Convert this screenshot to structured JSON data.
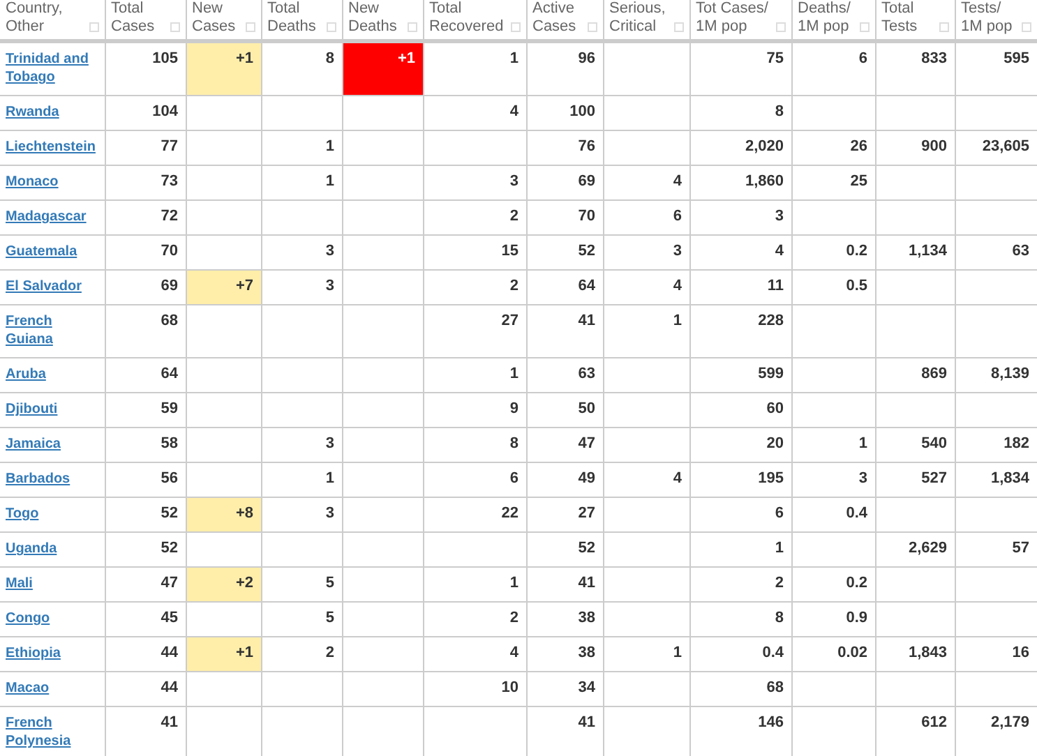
{
  "table": {
    "columns": [
      {
        "label": "Country, Other",
        "kind": "country"
      },
      {
        "label": "Total Cases",
        "kind": "total_cases"
      },
      {
        "label": "New Cases",
        "kind": "new_cases"
      },
      {
        "label": "Total Deaths",
        "kind": "number"
      },
      {
        "label": "New Deaths",
        "kind": "new_deaths"
      },
      {
        "label": "Total Recovered",
        "kind": "number"
      },
      {
        "label": "Active Cases",
        "kind": "number"
      },
      {
        "label": "Serious, Critical",
        "kind": "number"
      },
      {
        "label": "Tot Cases/ 1M pop",
        "kind": "number"
      },
      {
        "label": "Deaths/ 1M pop",
        "kind": "number"
      },
      {
        "label": "Total Tests",
        "kind": "number"
      },
      {
        "label": "Tests/ 1M pop",
        "kind": "number"
      }
    ],
    "rows": [
      {
        "cells": [
          "Trinidad and Tobago",
          "105",
          "+1",
          "8",
          "+1",
          "1",
          "96",
          null,
          "75",
          "6",
          "833",
          "595"
        ]
      },
      {
        "cells": [
          "Rwanda",
          "104",
          null,
          null,
          null,
          "4",
          "100",
          null,
          "8",
          null,
          null,
          null
        ]
      },
      {
        "cells": [
          "Liechtenstein",
          "77",
          null,
          "1",
          null,
          null,
          "76",
          null,
          "2,020",
          "26",
          "900",
          "23,605"
        ]
      },
      {
        "cells": [
          "Monaco",
          "73",
          null,
          "1",
          null,
          "3",
          "69",
          "4",
          "1,860",
          "25",
          null,
          null
        ]
      },
      {
        "cells": [
          "Madagascar",
          "72",
          null,
          null,
          null,
          "2",
          "70",
          "6",
          "3",
          null,
          null,
          null
        ]
      },
      {
        "cells": [
          "Guatemala",
          "70",
          null,
          "3",
          null,
          "15",
          "52",
          "3",
          "4",
          "0.2",
          "1,134",
          "63"
        ]
      },
      {
        "cells": [
          "El Salvador",
          "69",
          "+7",
          "3",
          null,
          "2",
          "64",
          "4",
          "11",
          "0.5",
          null,
          null
        ]
      },
      {
        "cells": [
          "French Guiana",
          "68",
          null,
          null,
          null,
          "27",
          "41",
          "1",
          "228",
          null,
          null,
          null
        ]
      },
      {
        "cells": [
          "Aruba",
          "64",
          null,
          null,
          null,
          "1",
          "63",
          null,
          "599",
          null,
          "869",
          "8,139"
        ]
      },
      {
        "cells": [
          "Djibouti",
          "59",
          null,
          null,
          null,
          "9",
          "50",
          null,
          "60",
          null,
          null,
          null
        ]
      },
      {
        "cells": [
          "Jamaica",
          "58",
          null,
          "3",
          null,
          "8",
          "47",
          null,
          "20",
          "1",
          "540",
          "182"
        ]
      },
      {
        "cells": [
          "Barbados",
          "56",
          null,
          "1",
          null,
          "6",
          "49",
          "4",
          "195",
          "3",
          "527",
          "1,834"
        ]
      },
      {
        "cells": [
          "Togo",
          "52",
          "+8",
          "3",
          null,
          "22",
          "27",
          null,
          "6",
          "0.4",
          null,
          null
        ]
      },
      {
        "cells": [
          "Uganda",
          "52",
          null,
          null,
          null,
          null,
          "52",
          null,
          "1",
          null,
          "2,629",
          "57"
        ]
      },
      {
        "cells": [
          "Mali",
          "47",
          "+2",
          "5",
          null,
          "1",
          "41",
          null,
          "2",
          "0.2",
          null,
          null
        ]
      },
      {
        "cells": [
          "Congo",
          "45",
          null,
          "5",
          null,
          "2",
          "38",
          null,
          "8",
          "0.9",
          null,
          null
        ]
      },
      {
        "cells": [
          "Ethiopia",
          "44",
          "+1",
          "2",
          null,
          "4",
          "38",
          "1",
          "0.4",
          "0.02",
          "1,843",
          "16"
        ]
      },
      {
        "cells": [
          "Macao",
          "44",
          null,
          null,
          null,
          "10",
          "34",
          null,
          "68",
          null,
          null,
          null
        ]
      },
      {
        "cells": [
          "French Polynesia",
          "41",
          null,
          null,
          null,
          null,
          "41",
          null,
          "146",
          null,
          "612",
          "2,179"
        ]
      }
    ]
  }
}
